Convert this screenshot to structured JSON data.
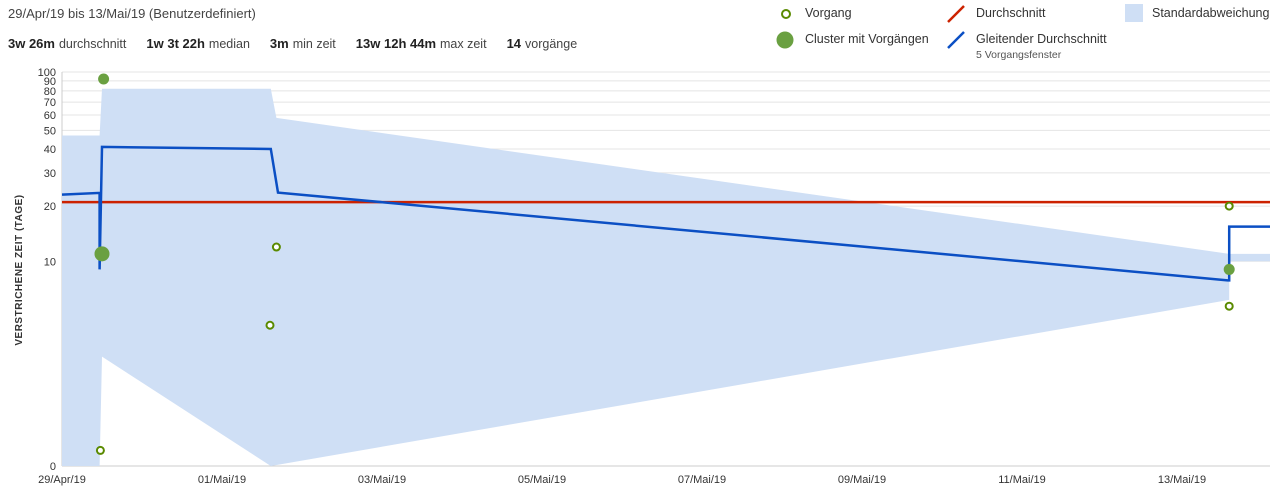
{
  "header": {
    "date_range": "29/Apr/19 bis 13/Mai/19 (Benutzerdefiniert)",
    "stats": [
      {
        "value": "3w 26m",
        "label": "durchschnitt"
      },
      {
        "value": "1w 3t 22h",
        "label": "median"
      },
      {
        "value": "3m",
        "label": "min zeit"
      },
      {
        "value": "13w 12h 44m",
        "label": "max zeit"
      },
      {
        "value": "14",
        "label": "vorgänge"
      }
    ]
  },
  "legend": {
    "vorgang": "Vorgang",
    "cluster": "Cluster mit Vorgängen",
    "durchschnitt": "Durchschnitt",
    "gleitender": "Gleitender Durchschnitt",
    "gleitender_sub": "5 Vorgangsfenster",
    "std": "Standardabweichung"
  },
  "colors": {
    "point_fill": "#ffffff",
    "point_stroke": "#5a8a00",
    "cluster": "#6aa041",
    "average": "#cc2200",
    "rolling": "#0b4fc4",
    "std_band": "#cfdff5"
  },
  "chart_data": {
    "type": "scatter",
    "ylabel": "VERSTRICHENE ZEIT (TAGE)",
    "y_scale": "symlog",
    "y_ticks": [
      0,
      10,
      20,
      30,
      40,
      50,
      60,
      70,
      80,
      90,
      100
    ],
    "x_tick_labels": [
      "29/Apr/19",
      "01/Mai/19",
      "03/Mai/19",
      "05/Mai/19",
      "07/Mai/19",
      "09/Mai/19",
      "11/Mai/19",
      "13/Mai/19"
    ],
    "x_range_days": [
      0,
      15.1
    ],
    "average_days": 21,
    "points": [
      {
        "day": 0.48,
        "y": 0.2,
        "kind": "vorgang"
      },
      {
        "day": 0.5,
        "y": 11,
        "kind": "cluster"
      },
      {
        "day": 0.52,
        "y": 92,
        "kind": "cluster"
      },
      {
        "day": 2.6,
        "y": 4.2,
        "kind": "vorgang"
      },
      {
        "day": 2.68,
        "y": 12,
        "kind": "vorgang"
      },
      {
        "day": 14.59,
        "y": 20,
        "kind": "vorgang"
      },
      {
        "day": 14.59,
        "y": 9,
        "kind": "cluster"
      },
      {
        "day": 14.59,
        "y": 5.5,
        "kind": "vorgang"
      }
    ],
    "rolling_average": [
      [
        0,
        23
      ],
      [
        0.47,
        23.5
      ],
      [
        0.47,
        9
      ],
      [
        0.5,
        41
      ],
      [
        2.61,
        40
      ],
      [
        2.7,
        23.6
      ],
      [
        14.57,
        7.8
      ],
      [
        14.59,
        7.8
      ],
      [
        14.59,
        15.5
      ],
      [
        15.1,
        15.5
      ]
    ],
    "std_upper": [
      [
        0,
        47
      ],
      [
        0.47,
        47
      ],
      [
        0.5,
        82
      ],
      [
        2.61,
        82
      ],
      [
        2.68,
        58
      ],
      [
        14.59,
        11
      ],
      [
        15.1,
        11
      ]
    ],
    "std_lower": [
      [
        0,
        0
      ],
      [
        0.47,
        0
      ],
      [
        0.5,
        2.6
      ],
      [
        2.61,
        0
      ],
      [
        14.59,
        6
      ],
      [
        14.59,
        10
      ],
      [
        15.1,
        10
      ]
    ]
  }
}
